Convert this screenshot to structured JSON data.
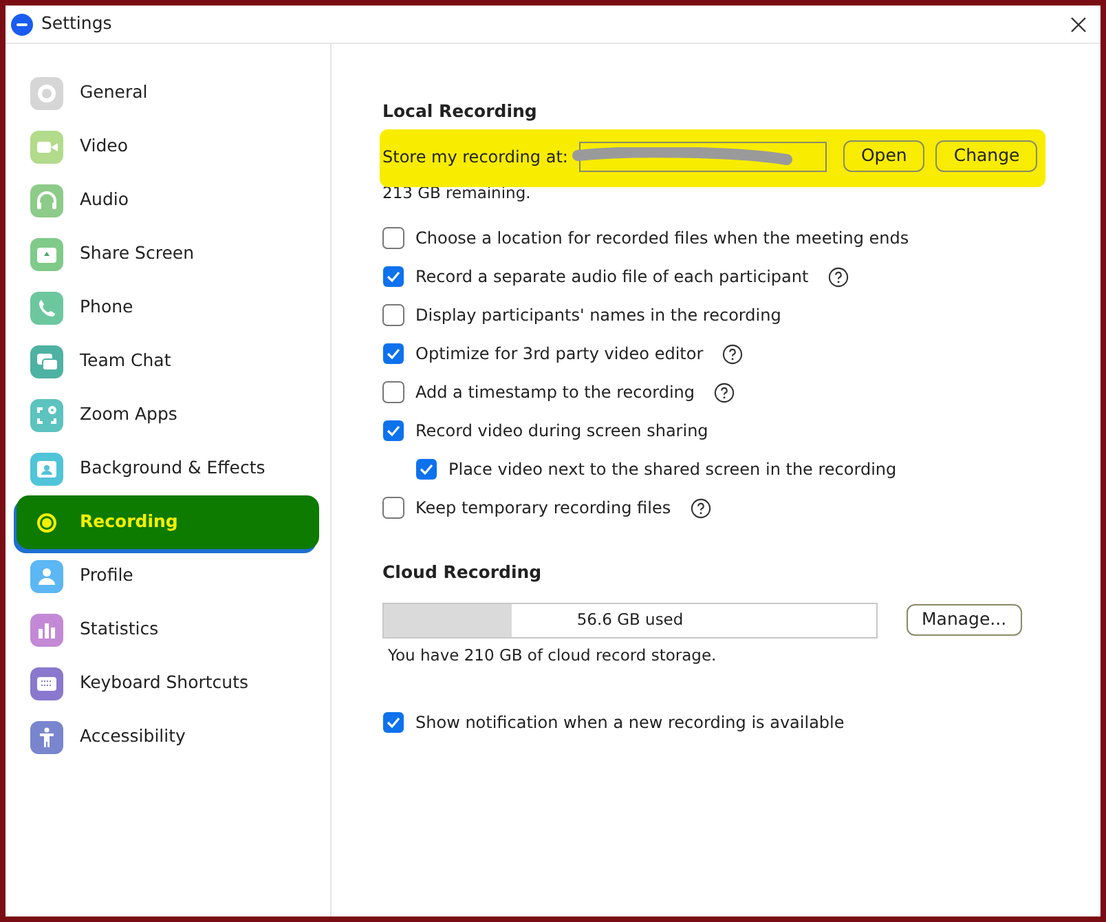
{
  "window": {
    "title": "Settings"
  },
  "sidebar": {
    "items": [
      {
        "label": "General",
        "selected": false,
        "color": "#d6d6d6"
      },
      {
        "label": "Video",
        "selected": false,
        "color": "#b3db8c"
      },
      {
        "label": "Audio",
        "selected": false,
        "color": "#8dcb89"
      },
      {
        "label": "Share Screen",
        "selected": false,
        "color": "#7fca89"
      },
      {
        "label": "Phone",
        "selected": false,
        "color": "#6cc79f"
      },
      {
        "label": "Team Chat",
        "selected": false,
        "color": "#4eb2a2"
      },
      {
        "label": "Zoom Apps",
        "selected": false,
        "color": "#5cc3bf"
      },
      {
        "label": "Background & Effects",
        "selected": false,
        "color": "#50c4d8"
      },
      {
        "label": "Recording",
        "selected": true
      },
      {
        "label": "Profile",
        "selected": false,
        "color": "#5cb7f4"
      },
      {
        "label": "Statistics",
        "selected": false,
        "color": "#c389d6"
      },
      {
        "label": "Keyboard Shortcuts",
        "selected": false,
        "color": "#8a78ce"
      },
      {
        "label": "Accessibility",
        "selected": false,
        "color": "#7986ce"
      }
    ]
  },
  "local_recording": {
    "title": "Local Recording",
    "store_label": "Store my recording at:",
    "buttons": [
      "Open",
      "Change"
    ],
    "remaining": "213 GB remaining.",
    "options": [
      {
        "label": "Choose a location for recorded files when the meeting ends",
        "checked": false,
        "help": false
      },
      {
        "label": "Record a separate audio file of each participant",
        "checked": true,
        "help": true
      },
      {
        "label": "Display participants' names in the recording",
        "checked": false,
        "help": false
      },
      {
        "label": "Optimize for 3rd party video editor",
        "checked": true,
        "help": true
      },
      {
        "label": "Add a timestamp to the recording",
        "checked": false,
        "help": true
      },
      {
        "label": "Record video during screen sharing",
        "checked": true,
        "help": false,
        "children": [
          {
            "label": "Place video next to the shared screen in the recording",
            "checked": true,
            "help": false
          }
        ]
      },
      {
        "label": "Keep temporary recording files",
        "checked": false,
        "help": true
      }
    ]
  },
  "cloud_recording": {
    "title": "Cloud Recording",
    "usage": {
      "level": 0.26,
      "reading": "56.6 GB used"
    },
    "button": "Manage...",
    "storage_note": "You have 210 GB of cloud record storage.",
    "options": [
      {
        "label": "Show notification when a new recording is available",
        "checked": true,
        "help": false
      }
    ]
  }
}
